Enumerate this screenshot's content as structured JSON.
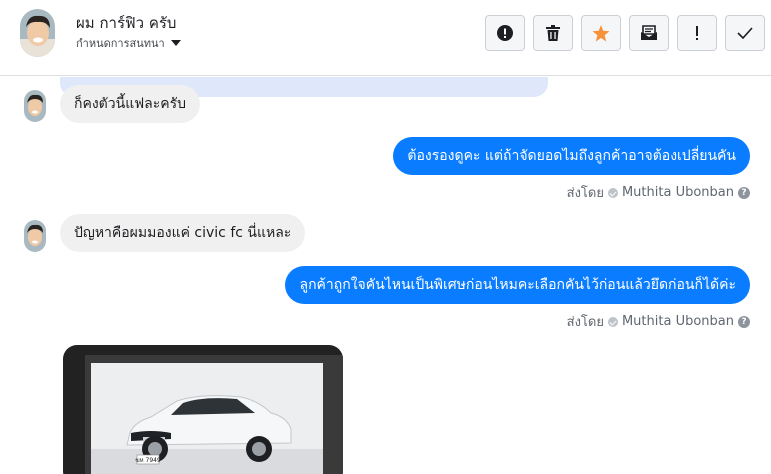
{
  "header": {
    "name": "ผม การ์ฟิว ครับ",
    "subtitle": "กำหนดการสนทนา",
    "actions": [
      {
        "icon": "alert-circle-icon"
      },
      {
        "icon": "trash-icon"
      },
      {
        "icon": "star-icon"
      },
      {
        "icon": "mark-unread-icon"
      },
      {
        "icon": "exclamation-icon"
      },
      {
        "icon": "checkmark-icon"
      }
    ]
  },
  "messages": [
    {
      "direction": "in",
      "text": "ก็คงตัวนี้แฟละครับ"
    },
    {
      "direction": "out",
      "text": "ต้องรองดูคะ แต่ถ้าจัดยอดไมถึงลูกค้าอาจต้องเปลี่ยนคัน",
      "sent_by_label": "ส่งโดย",
      "sent_by_name": "Muthita Ubonban"
    },
    {
      "direction": "in",
      "text": "ปัญหาคือผมมองแค่ civic fc นี่แหละ"
    },
    {
      "direction": "out",
      "text": "ลูกค้าถูกใจคันไหนเป็นพิเศษก่อนไหมคะเลือกคันไว้ก่อนแล้วยึดก่อนก็ได้ค่ะ",
      "sent_by_label": "ส่งโดย",
      "sent_by_name": "Muthita Ubonban"
    },
    {
      "direction": "in",
      "type": "image",
      "image_subject": "white-honda-civic-photo",
      "plate_text": "ฆห 7949"
    }
  ],
  "colors": {
    "outgoing_bubble": "#0a7cff",
    "incoming_bubble": "#f1f0f0",
    "star": "#f7923b"
  }
}
